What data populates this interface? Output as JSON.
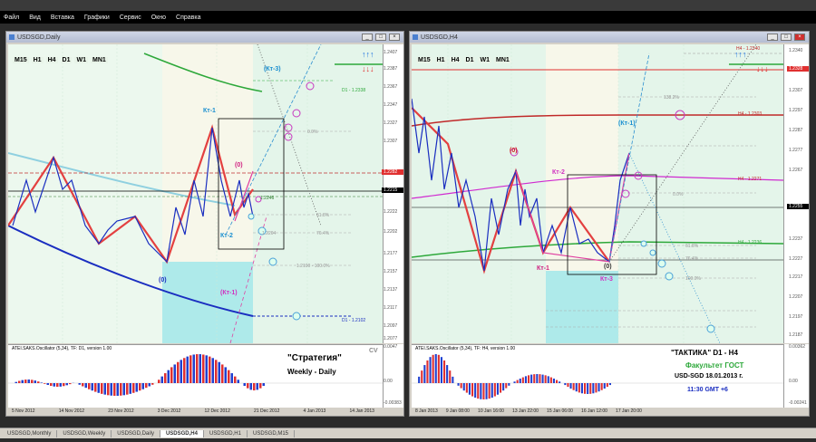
{
  "menu": [
    "Файл",
    "Вид",
    "Вставка",
    "Графики",
    "Сервис",
    "Окно",
    "Справка"
  ],
  "timeframes": [
    "M15",
    "H1",
    "H4",
    "D1",
    "W1",
    "MN1"
  ],
  "left": {
    "title": "USDSGD,Daily",
    "prices": [
      "1.2407",
      "1.2387",
      "1.2367",
      "1.2347",
      "1.2327",
      "1.2307",
      "1.2282",
      "1.2262",
      "1.2242",
      "1.2222",
      "1.2202",
      "1.2177",
      "1.2157",
      "1.2137",
      "1.2117",
      "1.2097",
      "1.2077"
    ],
    "current_price": "1.2215",
    "red_price": "1.2282",
    "labels": {
      "kt1": "Кт-1",
      "kt2": "Кт-2",
      "kt3": "(Кт-3)",
      "kt1b": "(Кт-1)",
      "zero_a": "(0)",
      "zero_b": "(0)",
      "d1a": "D1 - 1.2338",
      "d1b": "D1 - 1.2102",
      "fib1": "0.0%",
      "fib2": "61.8%",
      "fib3": "76.4%",
      "fib4": "100.0%",
      "lvl1": "1.2246",
      "lvl2": "1.2204",
      "lvl3": "1.2190 - 100.0%",
      "cv": "CV"
    },
    "osc_title": "ATEI.SAKS.Oscillator (5,34), TF: D1, version 1.00",
    "osc_prices": [
      "0.0047",
      "0.00",
      "-0.00383"
    ],
    "xaxis": [
      "5 Nov 2012",
      "14 Nov 2012",
      "23 Nov 2012",
      "3 Dec 2012",
      "12 Dec 2012",
      "21 Dec 2012",
      "4 Jan 2013",
      "14 Jan 2013"
    ],
    "strategy_title": "\"Стратегия\"",
    "strategy_sub": "Weekly - Daily"
  },
  "right": {
    "title": "USDSGD,H4",
    "prices": [
      "1.2340",
      "1.2328",
      "1.2307",
      "1.2297",
      "1.2287",
      "1.2277",
      "1.2267",
      "1.2257",
      "1.2247",
      "1.2237",
      "1.2227",
      "1.2217",
      "1.2207",
      "1.2197",
      "1.2187"
    ],
    "current_price": "1.2255",
    "red_price": "1.2328",
    "labels": {
      "kt1": "(Кт-1)",
      "kt2": "Кт-2",
      "kt3": "Кт-3",
      "kt1b": "Кт-1",
      "zero_a": "(0)",
      "zero_b": "(0)",
      "h4a": "H4 - 1.2340",
      "h4b": "H4 - 1.2303",
      "h4c": "H4 - 1.2271",
      "h4d": "H4 - 1.2236",
      "fib0": "0.0%",
      "fib62": "61.8%",
      "fib76": "76.4%",
      "fib100": "100.0%",
      "fib138": "138.2%"
    },
    "osc_title": "ATEI.SAKS.Oscillator (5,34), TF: H4, version 1.00",
    "osc_prices": [
      "0.00362",
      "0.00",
      "-0.00241"
    ],
    "xaxis": [
      "8 Jan 2013",
      "9 Jan 08:00",
      "10 Jan 16:00",
      "13 Jan 22:00",
      "15 Jan 06:00",
      "16 Jan 12:00",
      "17 Jan 20:00"
    ],
    "tactic_title": "\"ТАКТИКА\"    D1 - H4",
    "tactic_faculty": "Факультет ГОСТ",
    "tactic_pair": "USD-SGD    18.01.2013 г.",
    "tactic_time": "11:30     GMT +6"
  },
  "tabs": [
    "USDSGD,Monthly",
    "USDSGD,Weekly",
    "USDSGD,Daily",
    "USDSGD,H4",
    "USDSGD,H1",
    "USDSGD,M15"
  ],
  "active_tab": "USDSGD,H4"
}
